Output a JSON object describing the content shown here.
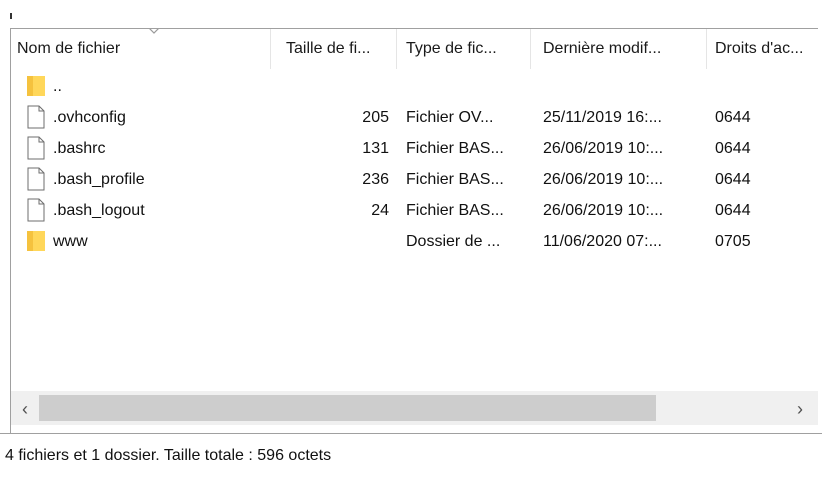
{
  "file_list": {
    "columns": [
      {
        "label": "Nom de fichier"
      },
      {
        "label": "Taille de fi..."
      },
      {
        "label": "Type de fic..."
      },
      {
        "label": "Dernière modif..."
      },
      {
        "label": "Droits d'ac..."
      }
    ],
    "rows": [
      {
        "name": "..",
        "size": "",
        "type": "",
        "modified": "",
        "rights": "",
        "icon": "folder-icon"
      },
      {
        "name": ".ovhconfig",
        "size": "205",
        "type": "Fichier OV...",
        "modified": "25/11/2019 16:...",
        "rights": "0644",
        "icon": "file-icon"
      },
      {
        "name": ".bashrc",
        "size": "131",
        "type": "Fichier BAS...",
        "modified": "26/06/2019 10:...",
        "rights": "0644",
        "icon": "file-icon"
      },
      {
        "name": ".bash_profile",
        "size": "236",
        "type": "Fichier BAS...",
        "modified": "26/06/2019 10:...",
        "rights": "0644",
        "icon": "file-icon"
      },
      {
        "name": ".bash_logout",
        "size": "24",
        "type": "Fichier BAS...",
        "modified": "26/06/2019 10:...",
        "rights": "0644",
        "icon": "file-icon"
      },
      {
        "name": "www",
        "size": "",
        "type": "Dossier de ...",
        "modified": "11/06/2020 07:...",
        "rights": "0705",
        "icon": "folder-icon"
      }
    ]
  },
  "scrollbar": {
    "left_arrow": "‹",
    "right_arrow": "›"
  },
  "status": {
    "text": "4 fichiers et 1 dossier. Taille totale : 596 octets"
  },
  "colors": {
    "folder": "#ffd75a",
    "border": "#a0a0a0",
    "scroll_track": "#f0f0f0",
    "scroll_thumb": "#cdcdcd"
  }
}
